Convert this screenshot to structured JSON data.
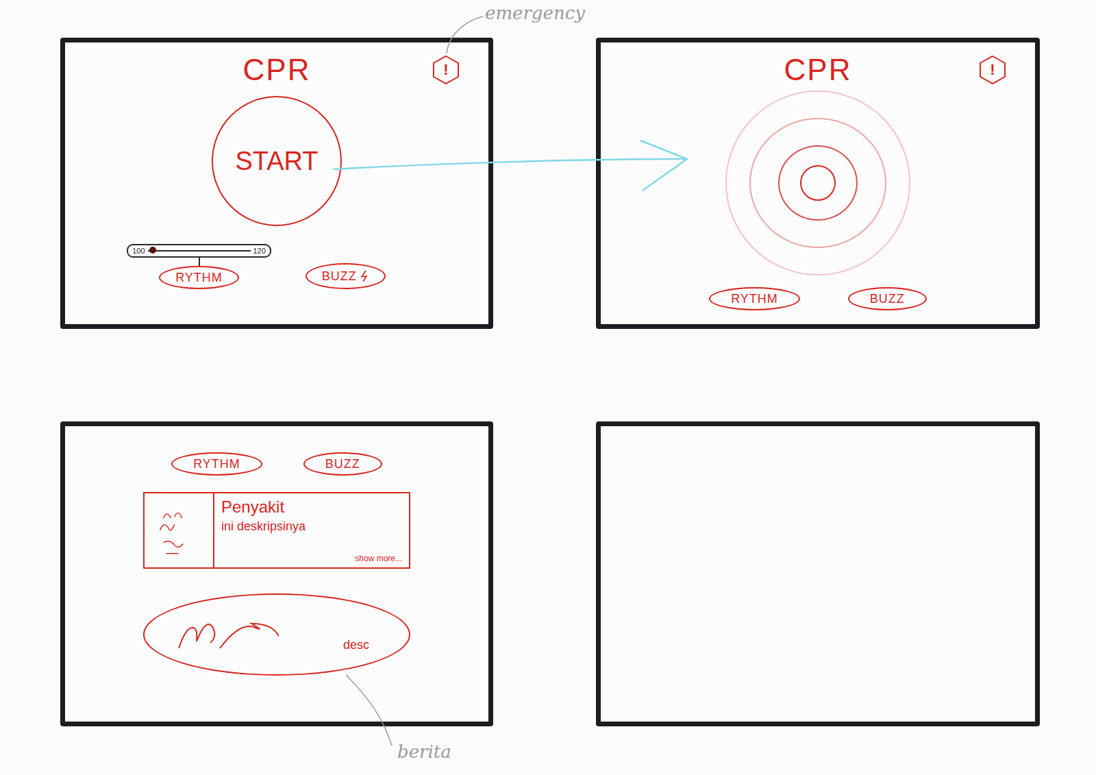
{
  "annotations": {
    "emergency": "emergency",
    "news": "berita"
  },
  "start_screen": {
    "title": "CPR",
    "emergency_icon": "!",
    "start_button": "START",
    "rate_slider": {
      "min": "100",
      "max": "120",
      "level": 0.05
    },
    "rhythm_button": "RYTHM",
    "buzz_button": "BUZZ"
  },
  "running_screen": {
    "title": "CPR",
    "emergency_icon": "!",
    "rhythm_button": "RYTHM",
    "buzz_button": "BUZZ"
  },
  "info_screen": {
    "rhythm_button": "RYTHM",
    "buzz_button": "BUZZ",
    "disease_card": {
      "title": "Penyakit",
      "description": "ini deskripsinya",
      "link": "show more..."
    },
    "news_card": {
      "label": "desc"
    }
  }
}
